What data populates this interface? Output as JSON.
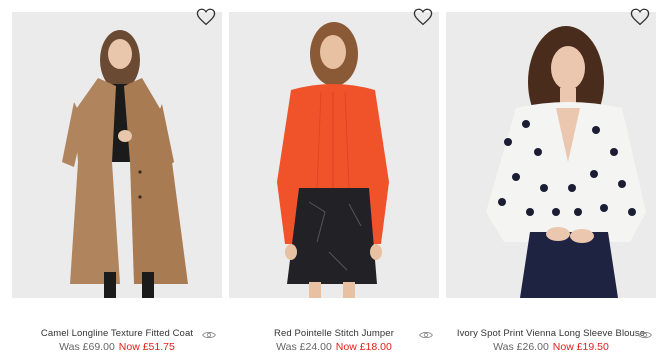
{
  "products": [
    {
      "name": "Camel Longline Texture Fitted Coat",
      "was_price": "Was £69.00",
      "now_price": "Now £51.75",
      "image_icon": "model-camel-coat-image",
      "colors": {
        "garment": "#b0855d",
        "background": "#ebebeb"
      }
    },
    {
      "name": "Red Pointelle Stitch Jumper",
      "was_price": "Was £24.00",
      "now_price": "Now £18.00",
      "image_icon": "model-red-jumper-image",
      "colors": {
        "garment": "#f0532a",
        "background": "#ebebeb"
      }
    },
    {
      "name": "Ivory Spot Print Vienna Long Sleeve Blouse",
      "was_price": "Was £26.00",
      "now_price": "Now £19.50",
      "image_icon": "model-spot-blouse-image",
      "colors": {
        "garment": "#f4f4f2",
        "background": "#ebebeb"
      }
    }
  ],
  "icons": {
    "wishlist": "heart-outline-icon",
    "quick_view": "eye-icon"
  },
  "colors": {
    "sale_price": "#e0211b",
    "was_price": "#666666",
    "text": "#333333"
  }
}
